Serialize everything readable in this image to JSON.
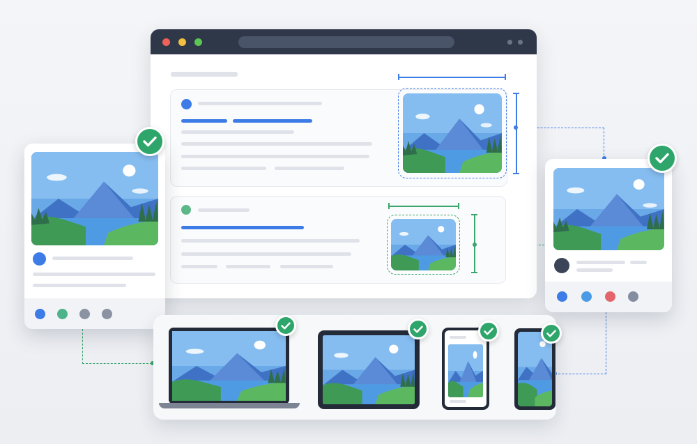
{
  "scene": {
    "accent_blue": "#3d7be6",
    "accent_green": "#2ea56a",
    "chrome_dark": "#2f3849",
    "icons": [
      "check-icon",
      "landscape-image-icon",
      "window-control-dots-icon"
    ]
  },
  "browser": {
    "window_controls": [
      "close",
      "minimize",
      "maximize"
    ],
    "url_text": ""
  },
  "devices": [
    "laptop",
    "tablet",
    "phone-small",
    "phone-tall"
  ],
  "verified_badges": 6
}
